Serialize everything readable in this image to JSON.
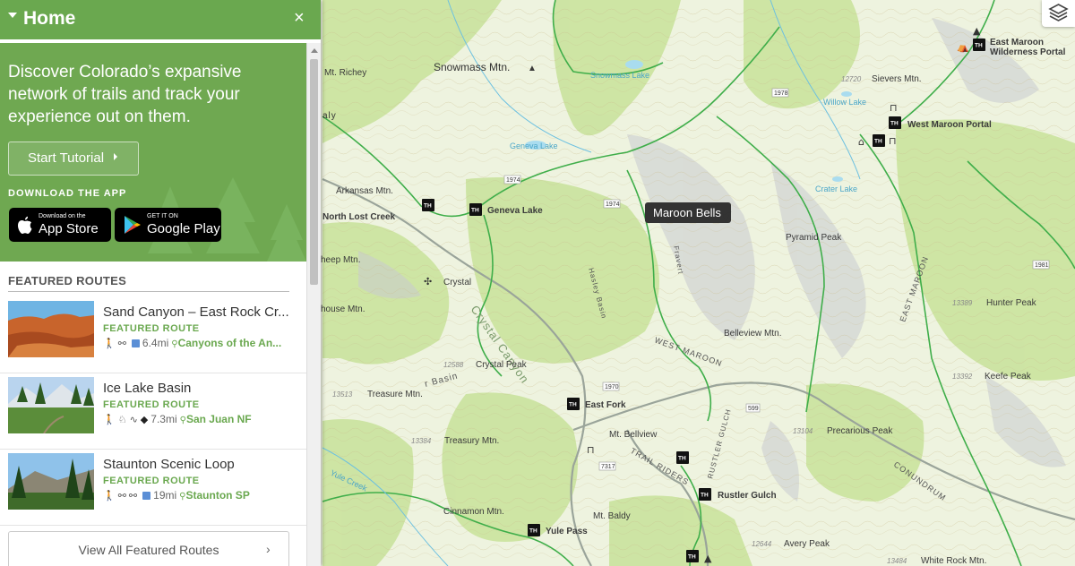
{
  "sidebar": {
    "title": "Home",
    "close_label": "×",
    "hero_text": "Discover Colorado’s expansive network of trails and track your experience out on them.",
    "tutorial_button": "Start Tutorial",
    "download_label": "DOWNLOAD THE APP",
    "app_store": {
      "small": "Download on the",
      "big": "App Store"
    },
    "google_play": {
      "small": "GET IT ON",
      "big": "Google Play"
    },
    "featured_header": "FEATURED ROUTES",
    "routes": [
      {
        "name": "Sand Canyon – East Rock Cr...",
        "tag": "FEATURED ROUTE",
        "distance": "6.4mi",
        "place": "Canyons of the An..."
      },
      {
        "name": "Ice Lake Basin",
        "tag": "FEATURED ROUTE",
        "distance": "7.3mi",
        "place": "San Juan NF"
      },
      {
        "name": "Staunton Scenic Loop",
        "tag": "FEATURED ROUTE",
        "distance": "19mi",
        "place": "Staunton SP"
      }
    ],
    "view_all": "View All Featured Routes"
  },
  "map": {
    "popup": "Maroon Bells",
    "peaks": {
      "snowmass": "Snowmass Mtn.",
      "richey": "Mt. Richey",
      "arkansas": "Arkansas Mtn.",
      "sheep": "heep Mtn.",
      "house": "house Mtn.",
      "pyramid": "Pyramid Peak",
      "belleview": "Belleview Mtn.",
      "hunter": "Hunter Peak",
      "keefe": "Keefe Peak",
      "precarious": "Precarious Peak",
      "sievers": "Sievers Mtn.",
      "treasure": "Treasure Mtn.",
      "treasury": "Treasury Mtn.",
      "crystal_peak": "Crystal Peak",
      "bellview": "Mt. Bellview",
      "cinnamon": "Cinnamon Mtn.",
      "baldy": "Mt. Baldy",
      "avery": "Avery Peak",
      "whiterock": "White Rock Mtn."
    },
    "trailheads": {
      "geneva": "Geneva Lake",
      "northlost": "North Lost Creek",
      "eastfork": "East Fork",
      "yulepass": "Yule Pass",
      "rustler": "Rustler Gulch",
      "westmaroon": "West Maroon Portal",
      "eastmaroon": "East Maroon\nWilderness Portal",
      "crystal": "Crystal"
    },
    "water": {
      "snowmass_lake": "Snowmass Lake",
      "geneva_lake": "Geneva Lake",
      "willow": "Willow Lake",
      "crater": "Crater Lake",
      "yule_creek": "Yule Creek"
    },
    "elevations": [
      "12720",
      "13389",
      "13392",
      "13104",
      "12588",
      "13513",
      "13384",
      "12644",
      "13484"
    ],
    "routes": [
      "1974",
      "1974",
      "1978",
      "1981",
      "1970",
      "599",
      "7317"
    ],
    "trail_labels": {
      "west_maroon": "WEST MAROON",
      "east_maroon": "EAST MAROON",
      "crystal_canyon": "Crystal Canyon",
      "trail_riders": "TRAIL RIDERS",
      "rustler": "RUSTLER GULCH",
      "conundrum": "CONUNDRUM",
      "fravert": "Fravert",
      "hasley": "Hasley Basin",
      "bear_basin": "r Basin",
      "ealy": "aly"
    }
  }
}
